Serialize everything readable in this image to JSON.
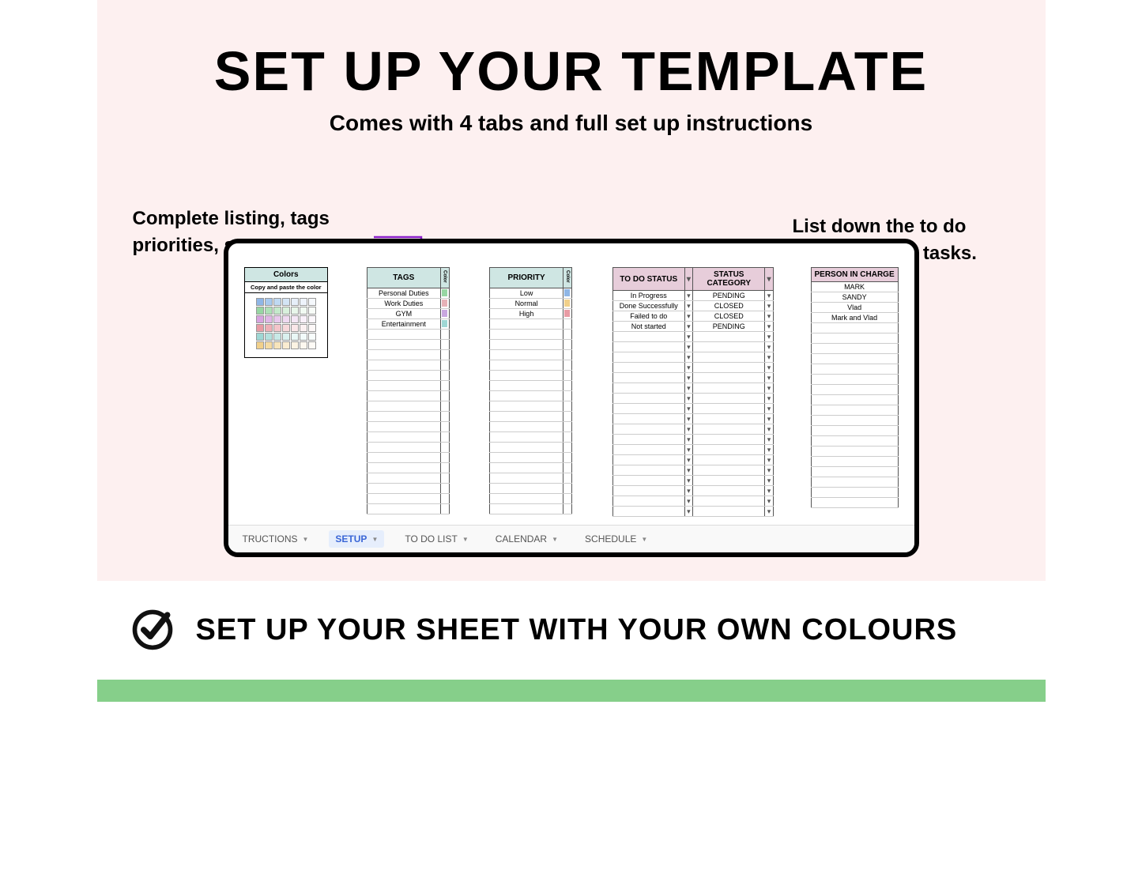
{
  "title": "SET UP YOUR TEMPLATE",
  "subtitle": "Comes with 4 tabs and full set up instructions",
  "callout_left": "Complete listing, tags priorities, statuses.",
  "callout_right": "List down the to do status of your tasks.",
  "colors_panel": {
    "header": "Colors",
    "hint": "Copy and paste the color",
    "swatches": [
      "#8fb6e6",
      "#a7c9ee",
      "#bfd9f2",
      "#d3e4f5",
      "#e6eef9",
      "#eef3fb",
      "#f5f8fc",
      "#97d6a3",
      "#aee0b7",
      "#c4e9cb",
      "#d8f0dc",
      "#e8f6ea",
      "#f1faf2",
      "#f8fcf8",
      "#d7a3e0",
      "#e0b6e6",
      "#e8c8ec",
      "#efd9f1",
      "#f5e7f6",
      "#f9f0fa",
      "#fcf7fc",
      "#e89ba4",
      "#eeb0b7",
      "#f3c5ca",
      "#f7d8db",
      "#fae7e9",
      "#fcf1f2",
      "#fdf8f8",
      "#9fd7d4",
      "#b4e1de",
      "#c8e9e7",
      "#daf1ef",
      "#e9f7f6",
      "#f2fbfa",
      "#f8fdfc",
      "#f1d08a",
      "#f4dba3",
      "#f7e4bb",
      "#faecd1",
      "#fcf3e3",
      "#fdf8ef",
      "#fefbf6"
    ]
  },
  "tags_table": {
    "header": "TAGS",
    "color_label": "Color",
    "rows": [
      {
        "name": "Personal Duties",
        "color": "#97d6a3"
      },
      {
        "name": "Work Duties",
        "color": "#e6b1b7"
      },
      {
        "name": "GYM",
        "color": "#c9a7e0"
      },
      {
        "name": "Entertainment",
        "color": "#9fd7d4"
      }
    ]
  },
  "priority_table": {
    "header": "PRIORITY",
    "color_label": "Color",
    "rows": [
      {
        "name": "Low",
        "color": "#8fb6e6"
      },
      {
        "name": "Normal",
        "color": "#f1d08a"
      },
      {
        "name": "High",
        "color": "#e89ba4"
      }
    ]
  },
  "status_table": {
    "header_status": "TO DO STATUS",
    "header_category": "STATUS CATEGORY",
    "rows": [
      {
        "status": "In Progress",
        "category": "PENDING"
      },
      {
        "status": "Done Successfully",
        "category": "CLOSED"
      },
      {
        "status": "Failed to do",
        "category": "CLOSED"
      },
      {
        "status": "Not started",
        "category": "PENDING"
      }
    ]
  },
  "person_table": {
    "header": "PERSON IN CHARGE",
    "rows": [
      "MARK",
      "SANDY",
      "Vlad",
      "Mark and Vlad"
    ]
  },
  "tabs": {
    "partial": "TRUCTIONS",
    "items": [
      "SETUP",
      "TO DO LIST",
      "CALENDAR",
      "SCHEDULE"
    ],
    "active": "SETUP"
  },
  "bottom_text": "SET UP YOUR SHEET WITH YOUR OWN COLOURS"
}
